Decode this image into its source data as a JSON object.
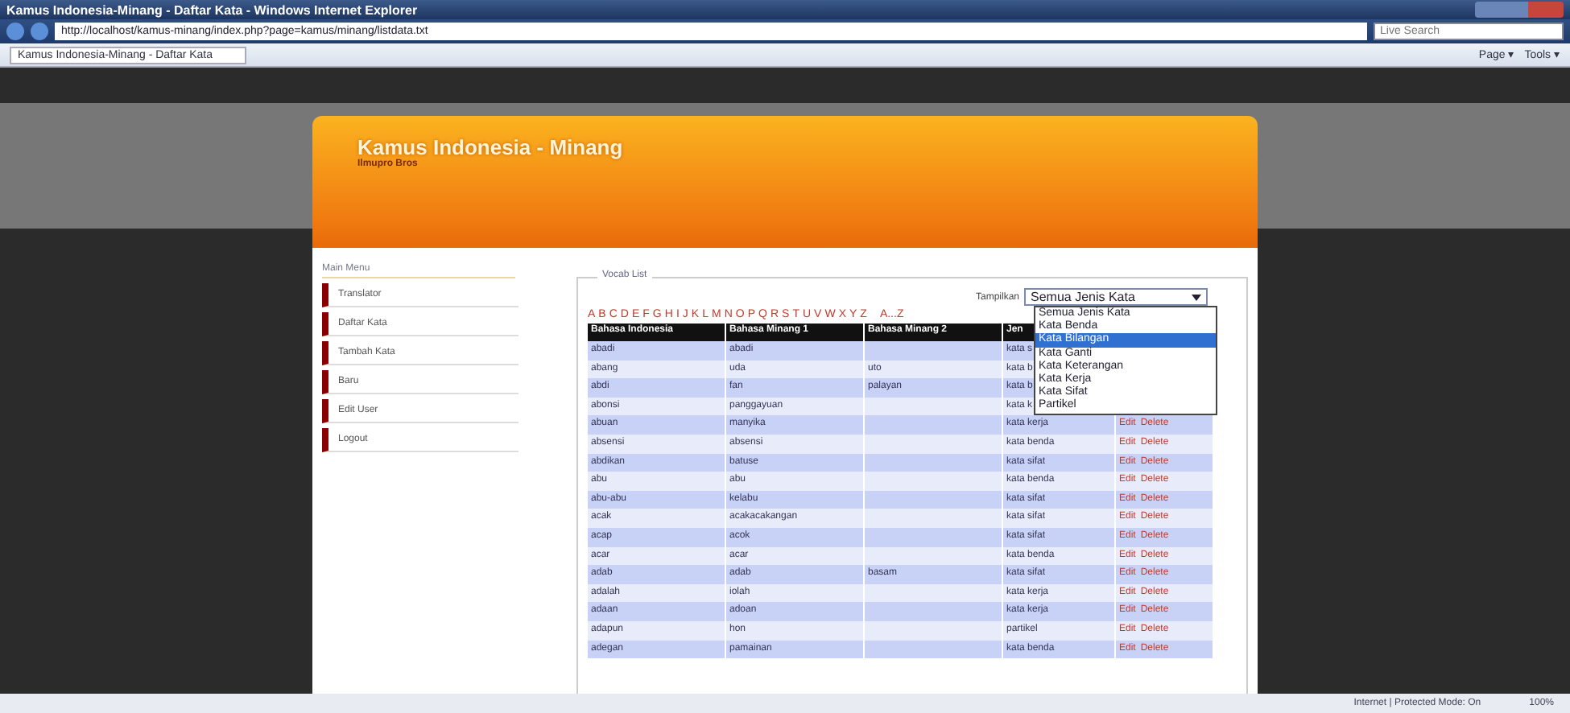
{
  "window": {
    "title": "Kamus Indonesia-Minang - Daftar Kata - Windows Internet Explorer"
  },
  "address_bar": {
    "url": "http://localhost/kamus-minang/index.php?page=kamus/minang/listdata.txt",
    "search_placeholder": "Live Search"
  },
  "tab": {
    "label": "Kamus Indonesia-Minang - Daftar Kata"
  },
  "command_bar": [
    "Page ▾",
    "Tools ▾"
  ],
  "header": {
    "title": "Kamus Indonesia - Minang",
    "subtitle": "Ilmupro Bros"
  },
  "sidebar": {
    "title": "Main Menu",
    "items": [
      {
        "label": "Translator",
        "selected": false
      },
      {
        "label": "Daftar Kata",
        "selected": false
      },
      {
        "label": "Tambah Kata",
        "selected": false
      },
      {
        "label": "Baru",
        "selected": false
      },
      {
        "label": "Edit User",
        "selected": false
      },
      {
        "label": "Logout",
        "selected": false
      }
    ]
  },
  "vocab": {
    "legend": "Vocab List",
    "filter_label": "Tampilkan",
    "filter_value": "Semua Jenis Kata",
    "filter_options": [
      {
        "label": "Semua Jenis Kata",
        "selected": false
      },
      {
        "label": "Kata Benda",
        "selected": false
      },
      {
        "label": "Kata Bilangan",
        "selected": true
      },
      {
        "label": "Kata Ganti",
        "selected": false
      },
      {
        "label": "Kata Keterangan",
        "selected": false
      },
      {
        "label": "Kata Kerja",
        "selected": false
      },
      {
        "label": "Kata Sifat",
        "selected": false
      },
      {
        "label": "Partikel",
        "selected": false
      }
    ],
    "letters": [
      "A",
      "B",
      "C",
      "D",
      "E",
      "F",
      "G",
      "H",
      "I",
      "J",
      "K",
      "L",
      "M",
      "N",
      "O",
      "P",
      "Q",
      "R",
      "S",
      "T",
      "U",
      "V",
      "W",
      "X",
      "Y",
      "Z"
    ],
    "all_letters": "A...Z",
    "columns": [
      "Bahasa Indonesia",
      "Bahasa Minang 1",
      "Bahasa Minang 2",
      "Jen"
    ],
    "rows": [
      {
        "cells": [
          "abadi",
          "abadi",
          "",
          "kata s"
        ],
        "actions": []
      },
      {
        "cells": [
          "abang",
          "uda",
          "uto",
          "kata b"
        ],
        "actions": []
      },
      {
        "cells": [
          "abdi",
          "fan",
          "palayan",
          "kata b"
        ],
        "actions": []
      },
      {
        "cells": [
          "abonsi",
          "panggayuan",
          "",
          "kata k"
        ],
        "actions": []
      },
      {
        "cells": [
          "abuan",
          "manyika",
          "",
          "kata kerja"
        ],
        "actions": [
          "Edit",
          "Delete"
        ]
      },
      {
        "cells": [
          "absensi",
          "absensi",
          "",
          "kata benda"
        ],
        "actions": [
          "Edit",
          "Delete"
        ]
      },
      {
        "cells": [
          "abdikan",
          "batuse",
          "",
          "kata sifat"
        ],
        "actions": [
          "Edit",
          "Delete"
        ]
      },
      {
        "cells": [
          "abu",
          "abu",
          "",
          "kata benda"
        ],
        "actions": [
          "Edit",
          "Delete"
        ]
      },
      {
        "cells": [
          "abu-abu",
          "kelabu",
          "",
          "kata sifat"
        ],
        "actions": [
          "Edit",
          "Delete"
        ]
      },
      {
        "cells": [
          "acak",
          "acakacakangan",
          "",
          "kata sifat"
        ],
        "actions": [
          "Edit",
          "Delete"
        ]
      },
      {
        "cells": [
          "acap",
          "acok",
          "",
          "kata sifat"
        ],
        "actions": [
          "Edit",
          "Delete"
        ]
      },
      {
        "cells": [
          "acar",
          "acar",
          "",
          "kata benda"
        ],
        "actions": [
          "Edit",
          "Delete"
        ]
      },
      {
        "cells": [
          "adab",
          "adab",
          "basam",
          "kata sifat"
        ],
        "actions": [
          "Edit",
          "Delete"
        ]
      },
      {
        "cells": [
          "adalah",
          "iolah",
          "",
          "kata kerja"
        ],
        "actions": [
          "Edit",
          "Delete"
        ]
      },
      {
        "cells": [
          "adaan",
          "adoan",
          "",
          "kata kerja"
        ],
        "actions": [
          "Edit",
          "Delete"
        ]
      },
      {
        "cells": [
          "adapun",
          "hon",
          "",
          "partikel"
        ],
        "actions": [
          "Edit",
          "Delete"
        ]
      },
      {
        "cells": [
          "adegan",
          "pamainan",
          "",
          "kata benda"
        ],
        "actions": [
          "Edit",
          "Delete"
        ]
      }
    ]
  },
  "status_bar": {
    "zone": "Internet | Protected Mode: On",
    "zoom": "100%"
  }
}
